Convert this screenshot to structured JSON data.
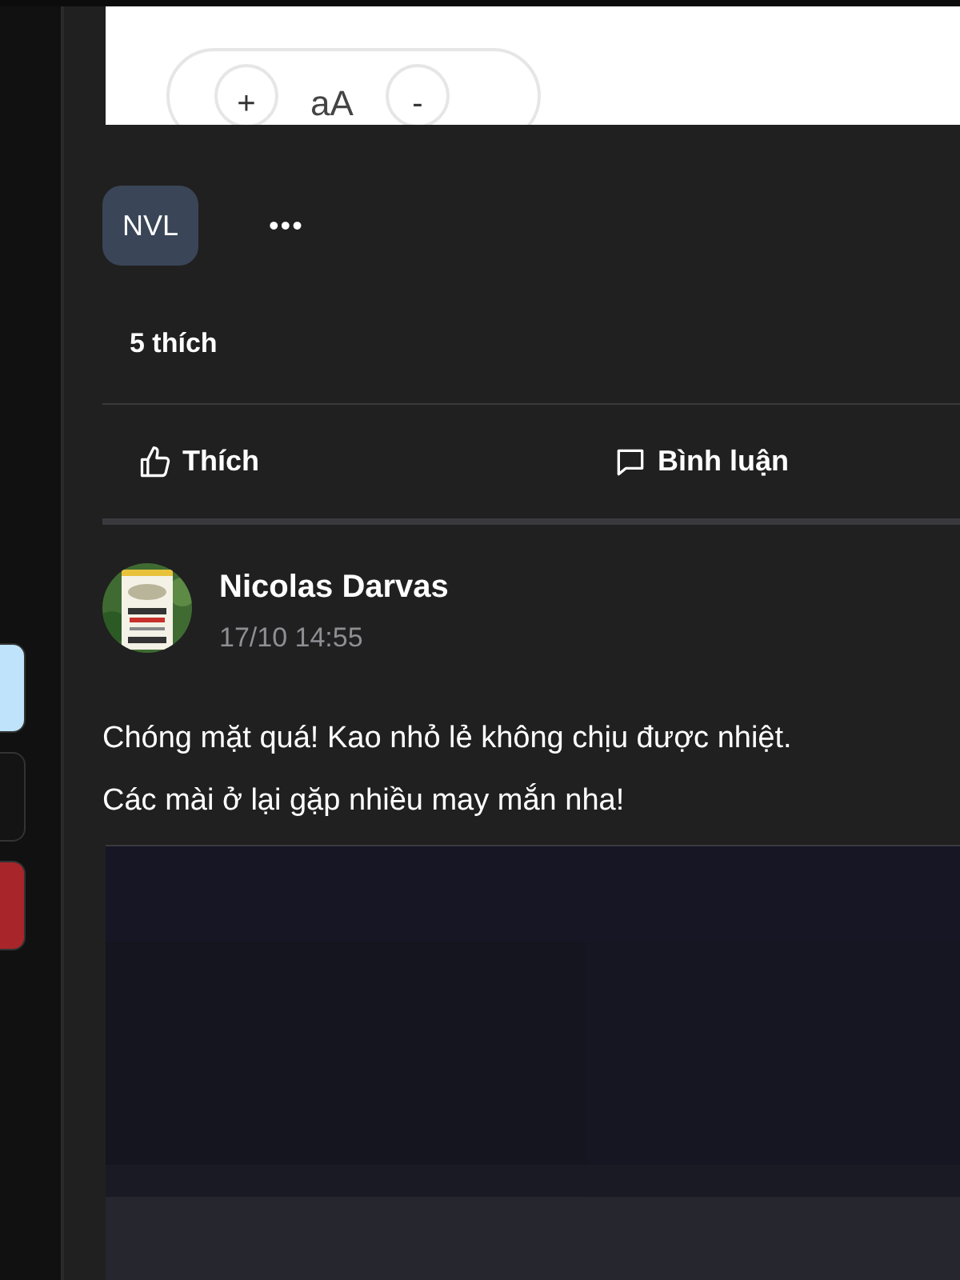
{
  "side_buttons": [
    {
      "color": "#bfe3fb"
    },
    {
      "color": "#141414"
    },
    {
      "color": "#a8262a"
    }
  ],
  "font_controls": [
    {
      "label": "+"
    },
    {
      "label": "aA"
    },
    {
      "label": "-"
    }
  ],
  "group": {
    "avatar_text": "NVL",
    "more": "•••"
  },
  "likes": "5 thích",
  "actions": [
    {
      "kind": "like",
      "label": "Thích"
    },
    {
      "kind": "comment",
      "label": "Bình luận"
    }
  ],
  "post": {
    "author": "Nicolas Darvas",
    "time": "17/10 14:55",
    "lines": [
      "Chóng mặt quá! Kao nhỏ lẻ không chịu được nhiệt.",
      "Các mài ở lại gặp nhiều may mắn nha!"
    ]
  }
}
